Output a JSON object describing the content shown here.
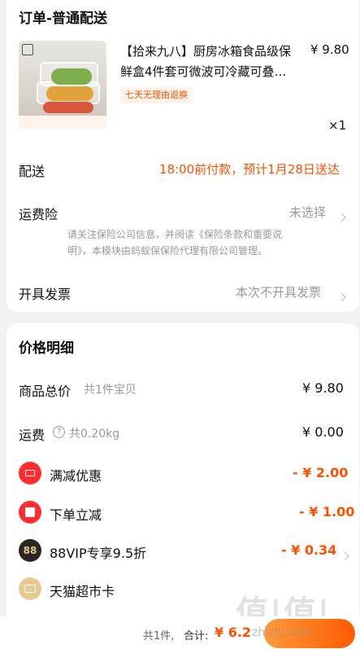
{
  "order_header": {
    "title": "订单-普通配送"
  },
  "product": {
    "name_line1": "【拾来九八】厨房冰箱食品级保",
    "name_line2": "鲜盒4件套可微波可冷藏可叠…",
    "price": "¥ 9.80",
    "qty": "×1",
    "tag": "七天无理由退换"
  },
  "delivery": {
    "label": "配送",
    "value": "18:00前付款，预计1月28日送达"
  },
  "insurance": {
    "label": "运费险",
    "value": "未选择",
    "note_line1": "请关注保险公司信息，并阅读《保险条款和重要说",
    "note_line2": "明》，本模块由蚂蚁保保险代理有限公司管理。"
  },
  "invoice": {
    "label": "开具发票",
    "value": "本次不开具发票"
  },
  "price_detail": {
    "title": "价格明细",
    "goods_total": {
      "label": "商品总价",
      "sub": "共1件宝贝",
      "value": "¥ 9.80"
    },
    "shipping": {
      "label": "运费",
      "sub": "共0.20kg",
      "value": "¥ 0.00"
    },
    "discounts": [
      {
        "label": "满减优惠",
        "value": "- ¥ 2.00",
        "icon": "ticket-icon",
        "color": "#ff2d2d"
      },
      {
        "label": "下单立减",
        "value": "- ¥ 1.00",
        "icon": "reduce-icon",
        "color": "#ff2d2d"
      },
      {
        "label": "88VIP专享9.5折",
        "value": "- ¥ 0.34",
        "icon": "vip88-icon",
        "color": "#2b2622"
      },
      {
        "label": "天猫超市卡",
        "value": "",
        "icon": "card-icon",
        "color": "#e8c893"
      }
    ]
  },
  "bottom_bar": {
    "count": "共1件,",
    "total_label": "合计:",
    "total_value": "¥ 6.2",
    "watermark": "值|值|值",
    "site": "zhizhi.com"
  },
  "colors": {
    "accent": "#ff5000",
    "background": "#f2f2f2"
  }
}
